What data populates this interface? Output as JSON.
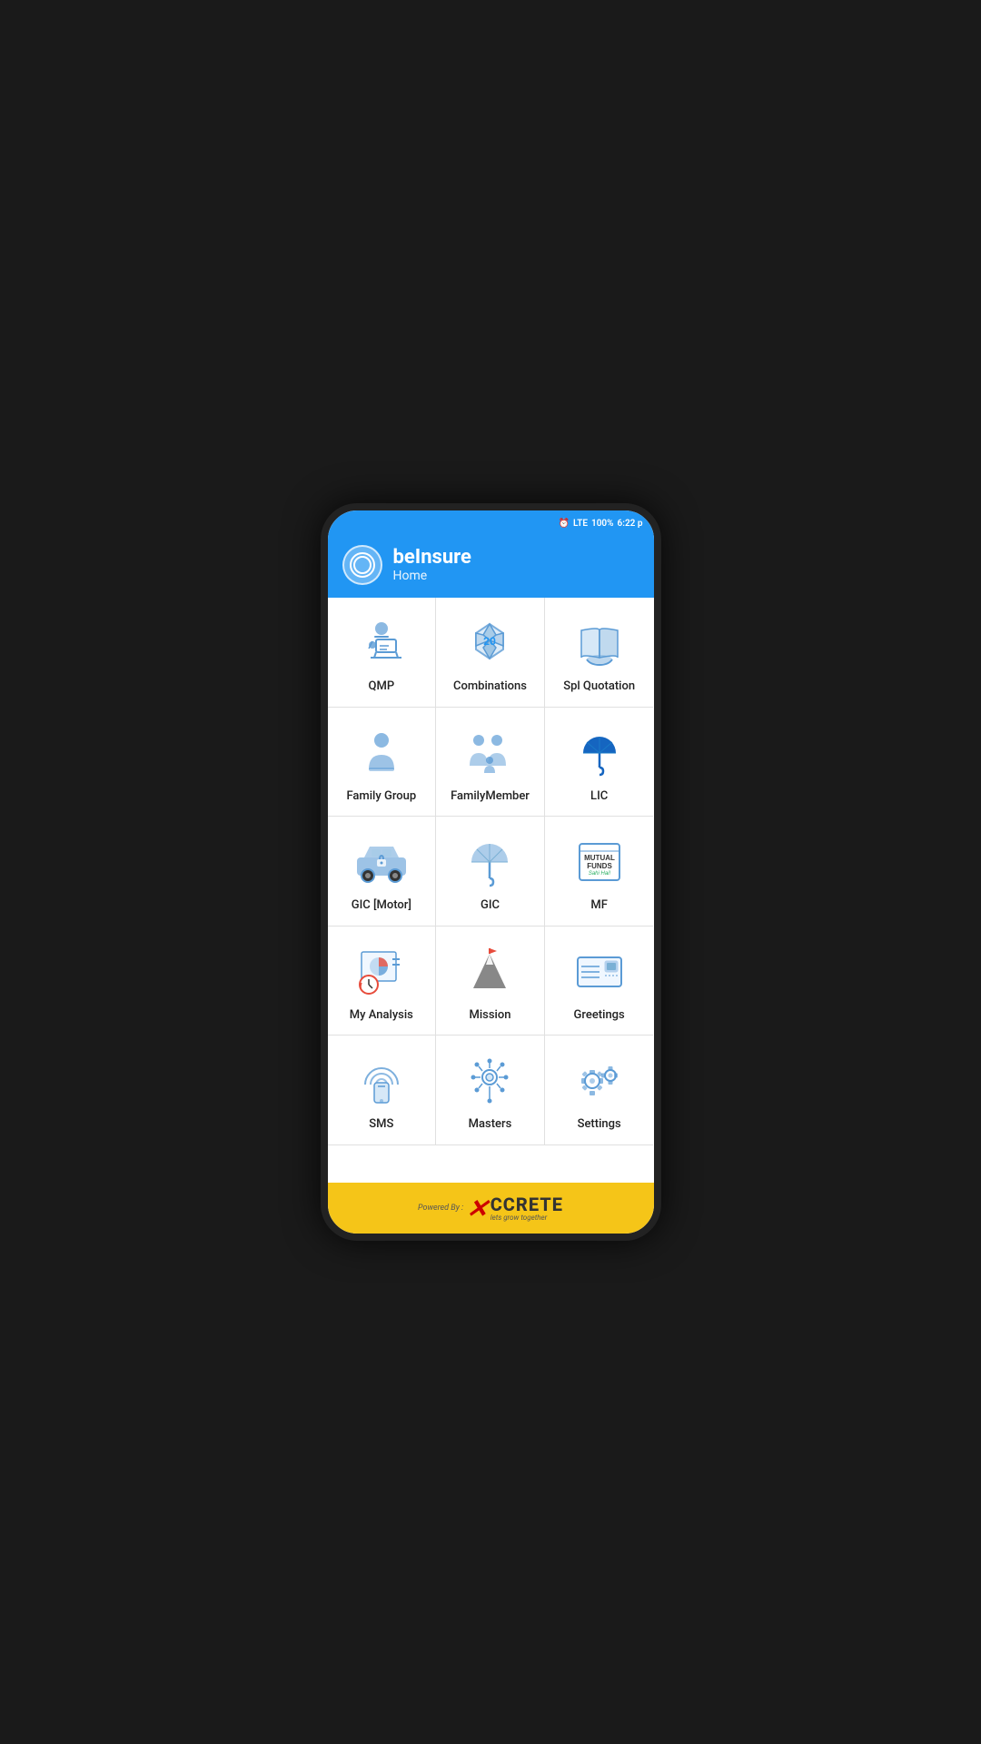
{
  "statusBar": {
    "time": "6:22 p",
    "battery": "100%",
    "signal": "LTE"
  },
  "header": {
    "appName": "beInsure",
    "subtitle": "Home"
  },
  "grid": {
    "items": [
      {
        "id": "qmp",
        "label": "QMP",
        "icon": "presenter"
      },
      {
        "id": "combinations",
        "label": "Combinations",
        "icon": "dice",
        "badge": "20"
      },
      {
        "id": "spl-quotation",
        "label": "Spl Quotation",
        "icon": "book"
      },
      {
        "id": "family-group",
        "label": "Family Group",
        "icon": "person"
      },
      {
        "id": "family-member",
        "label": "FamilyMember",
        "icon": "family"
      },
      {
        "id": "lic",
        "label": "LIC",
        "icon": "umbrella-blue"
      },
      {
        "id": "gic-motor",
        "label": "GIC [Motor]",
        "icon": "car"
      },
      {
        "id": "gic",
        "label": "GIC",
        "icon": "umbrella-gray"
      },
      {
        "id": "mf",
        "label": "MF",
        "icon": "mutual-funds"
      },
      {
        "id": "my-analysis",
        "label": "My Analysis",
        "icon": "analysis"
      },
      {
        "id": "mission",
        "label": "Mission",
        "icon": "mountain"
      },
      {
        "id": "greetings",
        "label": "Greetings",
        "icon": "card"
      },
      {
        "id": "sms",
        "label": "SMS",
        "icon": "sms"
      },
      {
        "id": "masters",
        "label": "Masters",
        "icon": "key"
      },
      {
        "id": "settings",
        "label": "Settings",
        "icon": "settings"
      }
    ]
  },
  "footer": {
    "poweredBy": "Powered By :",
    "brand": "CCRETE",
    "tagline": "lets grow together"
  }
}
